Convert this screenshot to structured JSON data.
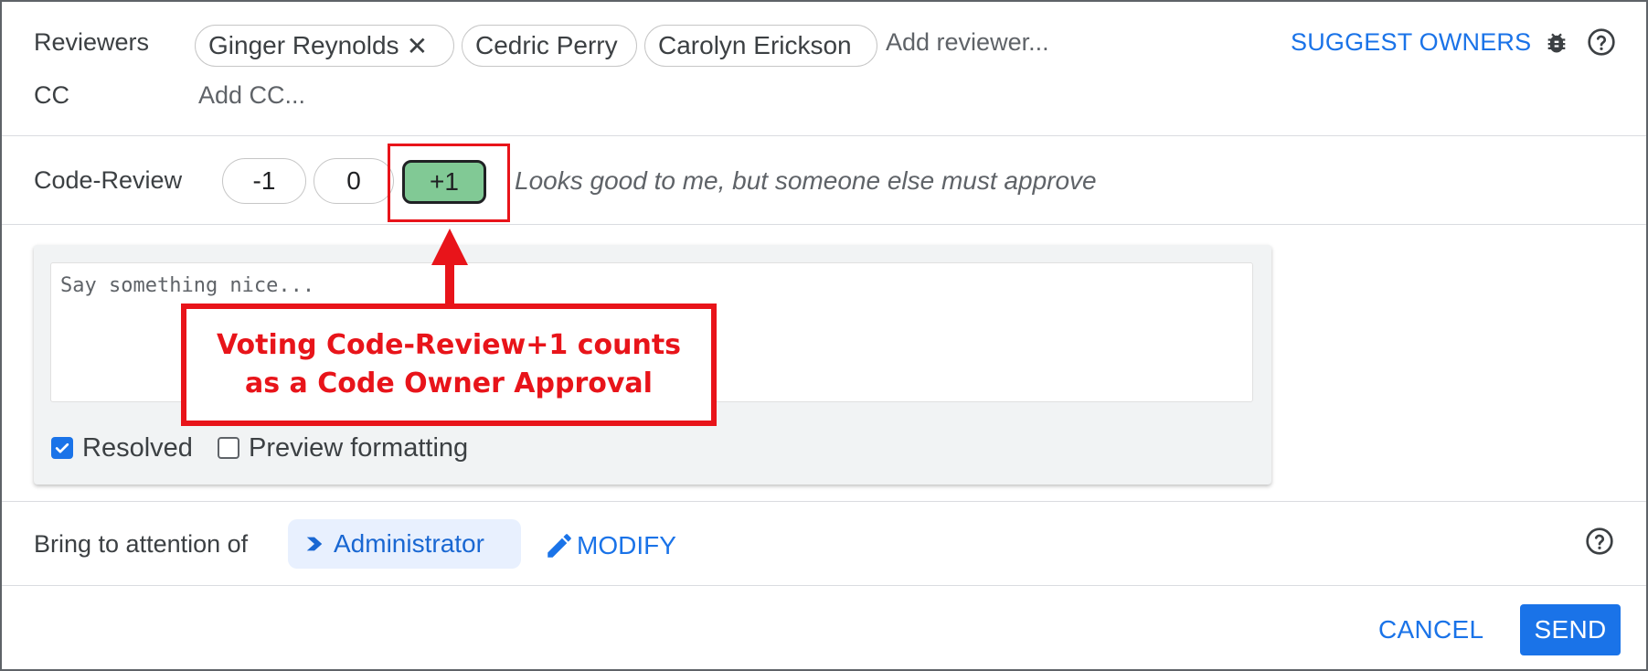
{
  "reviewers": {
    "label": "Reviewers",
    "chips": [
      {
        "name": "Ginger Reynolds",
        "removable": true
      },
      {
        "name": "Cedric Perry",
        "removable": false
      },
      {
        "name": "Carolyn Erickson",
        "removable": false
      }
    ],
    "remove_glyph": "✕",
    "add_placeholder": "Add reviewer...",
    "suggest_label": "SUGGEST OWNERS",
    "icons": [
      "bug-icon",
      "help-icon"
    ]
  },
  "cc": {
    "label": "CC",
    "add_placeholder": "Add CC..."
  },
  "code_review": {
    "label": "Code-Review",
    "votes": [
      "-1",
      "0",
      "+1"
    ],
    "selected": "+1",
    "description": "Looks good to me, but someone else must approve"
  },
  "comment": {
    "placeholder": "Say something nice...",
    "resolved_label": "Resolved",
    "resolved_checked": true,
    "preview_label": "Preview formatting",
    "preview_checked": false
  },
  "annotation": {
    "line1": "Voting Code-Review+1 counts",
    "line2": "as a Code Owner Approval"
  },
  "attention": {
    "label": "Bring to attention of",
    "user": "Administrator",
    "modify_label": "MODIFY"
  },
  "footer": {
    "cancel_label": "CANCEL",
    "send_label": "SEND"
  },
  "colors": {
    "accent": "#1a73e8",
    "vote_selected": "#81c995",
    "annotation_red": "#e8141a"
  }
}
